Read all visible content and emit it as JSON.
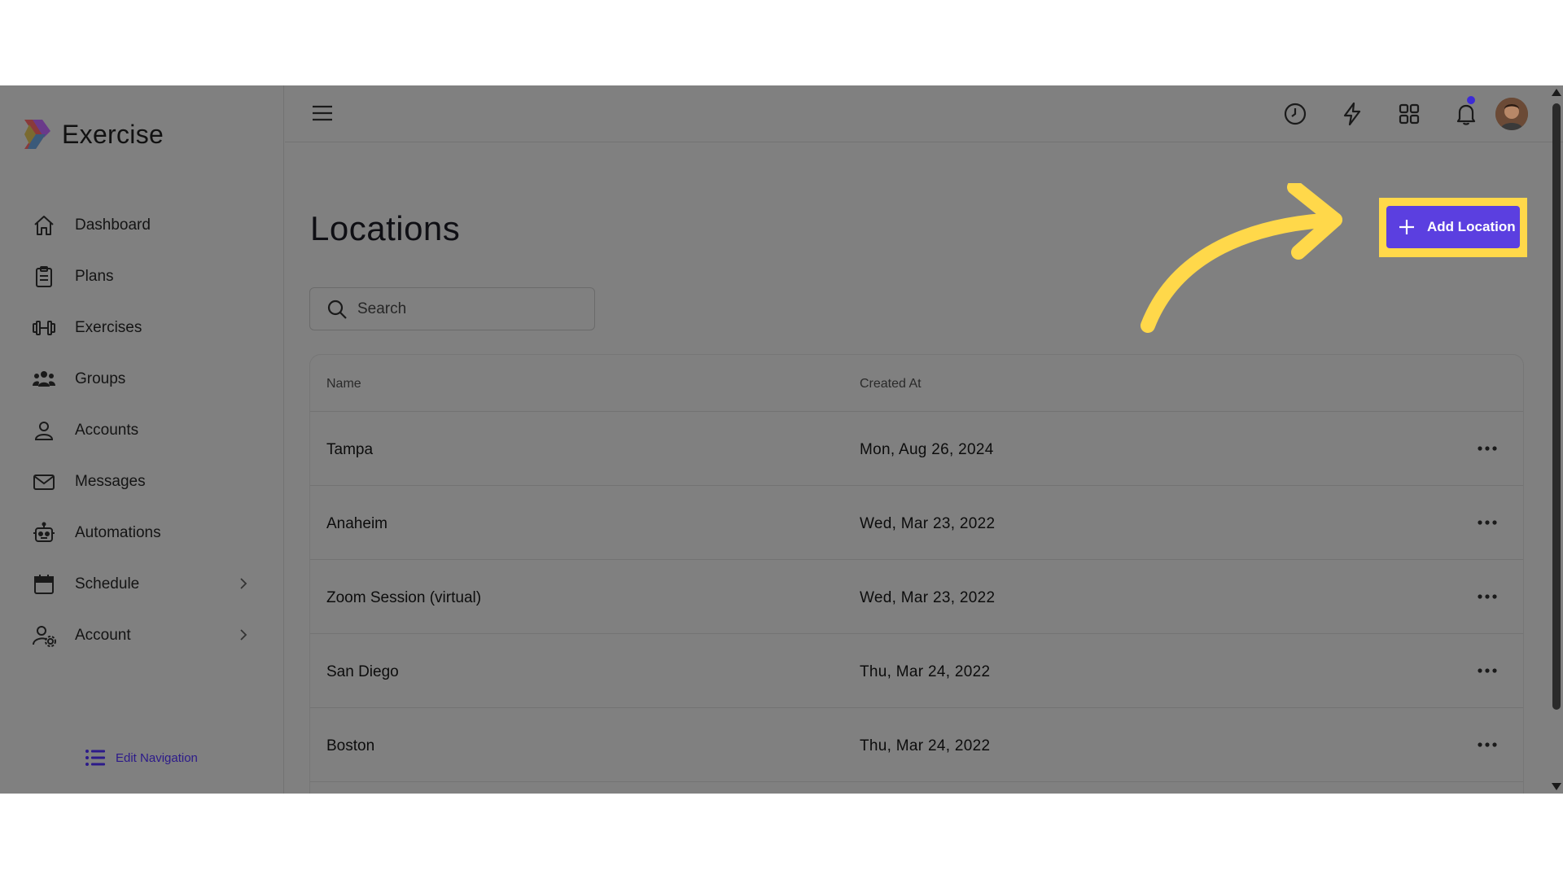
{
  "app": {
    "name": "Exercise"
  },
  "sidebar": {
    "items": [
      {
        "label": "Dashboard",
        "icon": "home-icon"
      },
      {
        "label": "Plans",
        "icon": "clipboard-icon"
      },
      {
        "label": "Exercises",
        "icon": "dumbbell-icon"
      },
      {
        "label": "Groups",
        "icon": "users-icon"
      },
      {
        "label": "Accounts",
        "icon": "user-icon"
      },
      {
        "label": "Messages",
        "icon": "mail-icon"
      },
      {
        "label": "Automations",
        "icon": "robot-icon"
      },
      {
        "label": "Schedule",
        "icon": "calendar-icon",
        "expandable": true
      },
      {
        "label": "Account",
        "icon": "user-gear-icon",
        "expandable": true
      }
    ],
    "edit_nav_label": "Edit Navigation"
  },
  "topbar": {
    "icons": [
      "menu-icon",
      "clock-icon",
      "bolt-icon",
      "grid-icon",
      "bell-icon",
      "avatar"
    ]
  },
  "page": {
    "title": "Locations",
    "add_button_label": "Add Location",
    "search_placeholder": "Search"
  },
  "table": {
    "columns": [
      "Name",
      "Created At"
    ],
    "rows": [
      {
        "name": "Tampa",
        "created_at": "Mon, Aug 26, 2024"
      },
      {
        "name": "Anaheim",
        "created_at": "Wed, Mar 23, 2022"
      },
      {
        "name": "Zoom Session (virtual)",
        "created_at": "Wed, Mar 23, 2022"
      },
      {
        "name": "San Diego",
        "created_at": "Thu, Mar 24, 2022"
      },
      {
        "name": "Boston",
        "created_at": "Thu, Mar 24, 2022"
      }
    ]
  },
  "colors": {
    "overlay_background": "#808080",
    "accent": "#5b3fe0",
    "highlight": "#ffd84a",
    "notification_dot": "#3d2bd6"
  }
}
